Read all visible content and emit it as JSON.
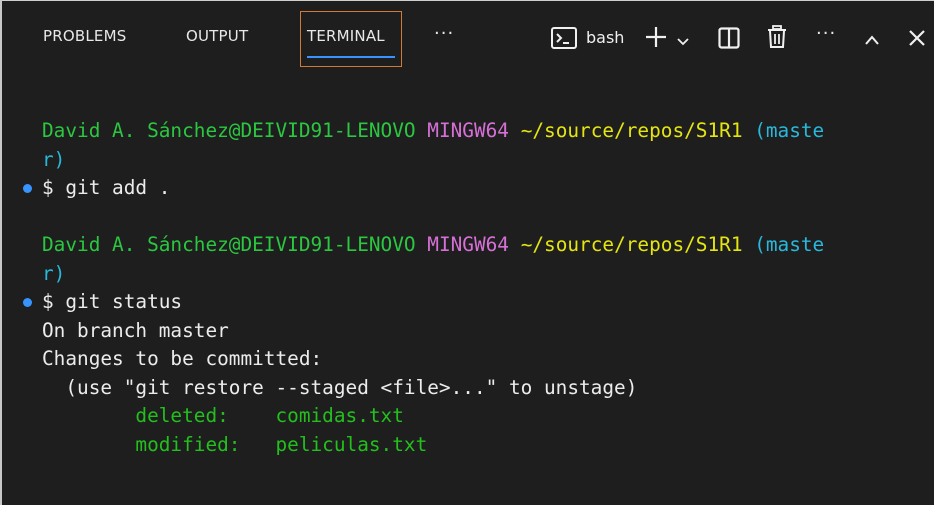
{
  "tabs": {
    "problems": "PROBLEMS",
    "output": "OUTPUT",
    "terminal": "TERMINAL",
    "more": "···"
  },
  "toolbar": {
    "shell_label": "bash",
    "more": "···"
  },
  "terminal": {
    "prompt1": {
      "user_host": "David A. Sánchez@DEIVID91-LENOVO",
      "env": "MINGW64",
      "path": "~/source/repos/S1R1",
      "branch_a": "(maste",
      "branch_b": "r)",
      "command": "$ git add ."
    },
    "prompt2": {
      "user_host": "David A. Sánchez@DEIVID91-LENOVO",
      "env": "MINGW64",
      "path": "~/source/repos/S1R1",
      "branch_a": "(maste",
      "branch_b": "r)",
      "command": "$ git status"
    },
    "output": {
      "line1": "On branch master",
      "line2": "Changes to be committed:",
      "line3": "  (use \"git restore --staged <file>...\" to unstage)",
      "deleted_label": "        deleted:    ",
      "deleted_file": "comidas.txt",
      "modified_label": "        modified:   ",
      "modified_file": "peliculas.txt"
    }
  },
  "colors": {
    "user_host": "#2bc740",
    "env": "#d670d6",
    "path": "#e5e510",
    "branch": "#29b8db",
    "accent": "#3794ff",
    "active_box": "#d07a3a"
  }
}
